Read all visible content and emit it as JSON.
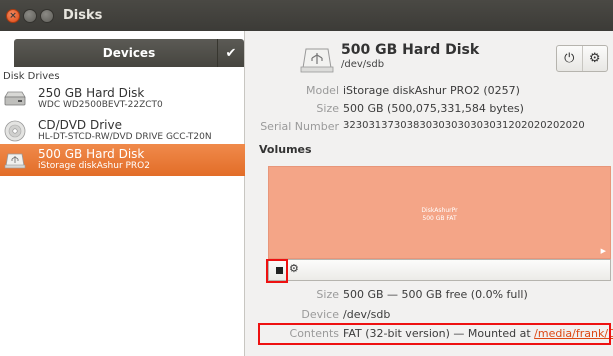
{
  "window": {
    "title": "Disks"
  },
  "sidebar": {
    "header": "Devices",
    "check_icon": "check-icon",
    "group_label": "Disk Drives",
    "drives": [
      {
        "name": "250 GB Hard Disk",
        "sub": "WDC WD2500BEVT-22ZCT0",
        "icon": "harddisk-icon"
      },
      {
        "name": "CD/DVD Drive",
        "sub": "HL-DT-STCD-RW/DVD DRIVE GCC-T20N",
        "icon": "optical-drive-icon"
      },
      {
        "name": "500 GB Hard Disk",
        "sub": "iStorage diskAshur PRO2",
        "icon": "usb-disk-icon",
        "selected": true
      }
    ]
  },
  "detail": {
    "title": "500 GB Hard Disk",
    "path": "/dev/sdb",
    "power_icon": "power-icon",
    "gear_icon": "gear-icon",
    "model_label": "Model",
    "model_value": "iStorage diskAshur PRO2 (0257)",
    "size_label": "Size",
    "size_value": "500 GB (500,075,331,584 bytes)",
    "serial_label": "Serial Number",
    "serial_value": "32303137303830303030303031202020202020",
    "volumes_heading": "Volumes",
    "volume_name": "DiskAshurPr",
    "volume_info": "500 GB FAT",
    "vol_size_label": "Size",
    "vol_size_value": "500 GB — 500 GB free (0.0% full)",
    "device_label": "Device",
    "device_value": "/dev/sdb",
    "contents_label": "Contents",
    "contents_value": "FAT (32-bit version) — Mounted at ",
    "contents_link": "/media/frank/Disk..."
  },
  "colors": {
    "accent": "#e26d28",
    "volume": "#f4a587",
    "highlight": "#e11111"
  }
}
